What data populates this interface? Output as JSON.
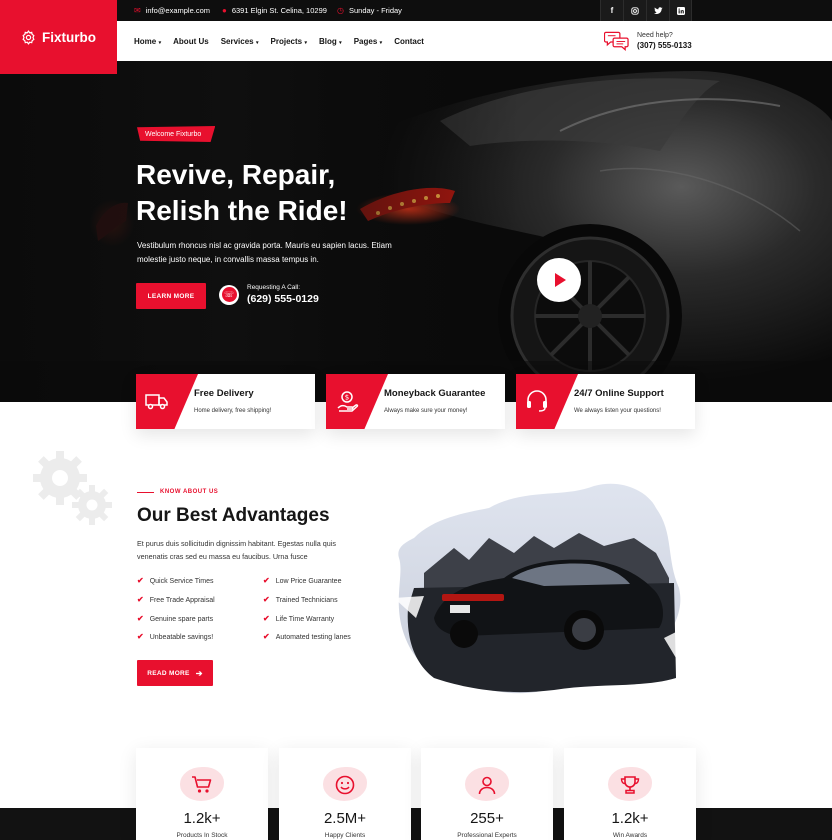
{
  "colors": {
    "accent": "#e8102e",
    "dark": "#0e0e0e",
    "text": "#161616"
  },
  "topbar": {
    "email": "info@example.com",
    "address": "6391 Elgin St. Celina, 10299",
    "hours": "Sunday - Friday",
    "socials": [
      "f",
      "ig",
      "tw",
      "in"
    ]
  },
  "header": {
    "brand": "Fixturbo",
    "nav": [
      "Home",
      "About Us",
      "Services",
      "Projects",
      "Blog",
      "Pages",
      "Contact"
    ],
    "help_label": "Need help?",
    "help_phone": "(307) 555-0133"
  },
  "hero": {
    "badge": "Welcome Fixturbo",
    "title_line1": "Revive, Repair,",
    "title_line2": "Relish the Ride!",
    "text": "Vestibulum rhoncus nisl ac gravida porta. Mauris eu sapien lacus. Etiam molestie justo neque, in convallis massa tempus in.",
    "button": "LEARN MORE",
    "call_label": "Requesting A Call:",
    "call_phone": "(629) 555-0129"
  },
  "features": [
    {
      "title": "Free Delivery",
      "subtitle": "Home delivery, free shipping!",
      "icon": "truck-icon"
    },
    {
      "title": "Moneyback Guarantee",
      "subtitle": "Always make sure your money!",
      "icon": "money-hand-icon"
    },
    {
      "title": "24/7 Online Support",
      "subtitle": "We always listen your questions!",
      "icon": "headset-icon"
    }
  ],
  "about": {
    "kicker": "KNOW ABOUT US",
    "title": "Our Best Advantages",
    "text": "Et purus duis sollicitudin dignissim habitant. Egestas nulla quis venenatis cras sed eu massa eu faucibus. Urna fusce",
    "checks": [
      "Quick Service Times",
      "Low Price Guarantee",
      "Free Trade Appraisal",
      "Trained Technicians",
      "Genuine spare parts",
      "Life Time Warranty",
      "Unbeatable savings!",
      "Automated testing lanes"
    ],
    "button": "READ MORE"
  },
  "stats": [
    {
      "value": "1.2k+",
      "label": "Products In Stock",
      "icon": "cart-icon"
    },
    {
      "value": "2.5M+",
      "label": "Happy Clients",
      "icon": "smiley-icon"
    },
    {
      "value": "255+",
      "label": "Professional Experts",
      "icon": "user-icon"
    },
    {
      "value": "1.2k+",
      "label": "Win Awards",
      "icon": "trophy-icon"
    }
  ]
}
